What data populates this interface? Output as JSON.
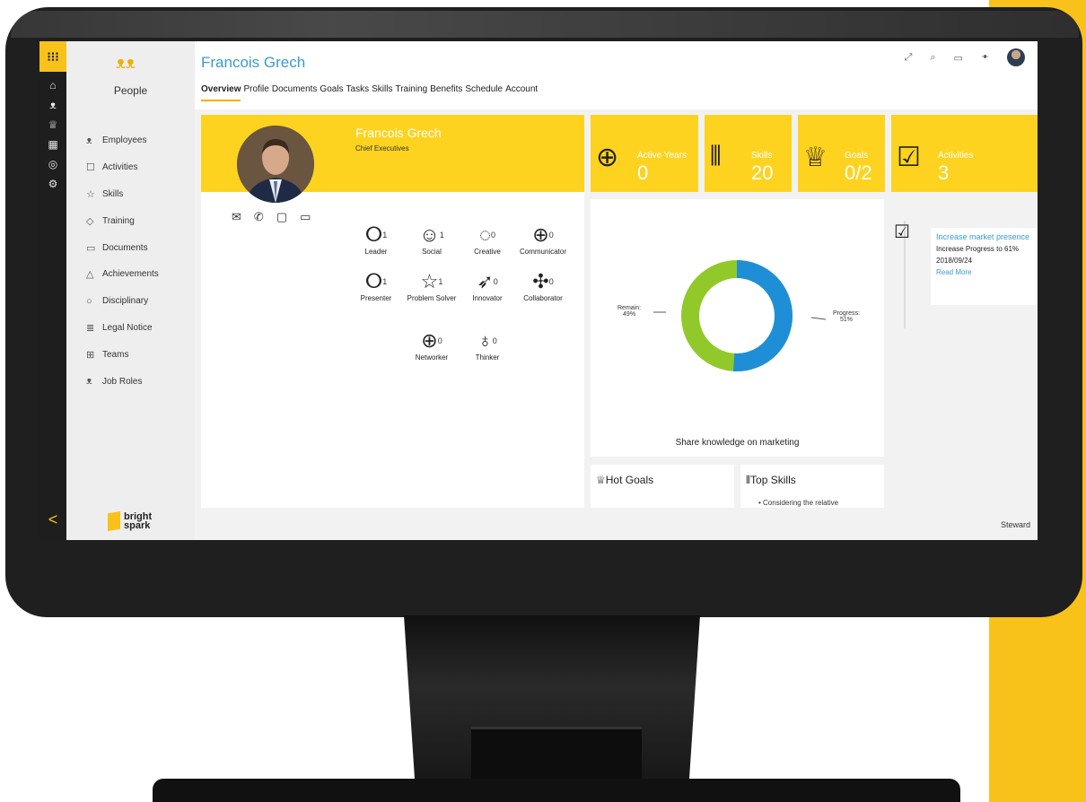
{
  "rail": {
    "icons": [
      "apps-waffle-icon",
      "home-icon",
      "people-icon",
      "trophy-icon",
      "calendar-icon",
      "target-icon",
      "settings-icon"
    ],
    "collapse_glyph": "<"
  },
  "sidebar": {
    "title": "People",
    "items": [
      {
        "label": "Employees",
        "icon": "people-icon"
      },
      {
        "label": "Activities",
        "icon": "clipboard-icon"
      },
      {
        "label": "Skills",
        "icon": "star-icon"
      },
      {
        "label": "Training",
        "icon": "graduation-icon"
      },
      {
        "label": "Documents",
        "icon": "document-icon"
      },
      {
        "label": "Achievements",
        "icon": "achievement-icon"
      },
      {
        "label": "Disciplinary",
        "icon": "disciplinary-icon"
      },
      {
        "label": "Legal Notice",
        "icon": "legal-icon"
      },
      {
        "label": "Teams",
        "icon": "teams-icon"
      },
      {
        "label": "Job Roles",
        "icon": "job-roles-icon"
      }
    ],
    "logo": {
      "line1": "bright",
      "line2": "spark"
    }
  },
  "header": {
    "title": "Francois Grech",
    "tabs": [
      "Overview",
      "Profile",
      "Documents",
      "Goals",
      "Tasks",
      "Skills",
      "Training",
      "Benefits",
      "Schedule",
      "Account"
    ],
    "active_tab": "Overview",
    "icons": [
      "expand-icon",
      "search-icon",
      "chat-icon",
      "org-chart-icon",
      "user-avatar"
    ]
  },
  "profile": {
    "name": "Francois Grech",
    "role": "Chief Executives",
    "contact_icons": [
      "mail-icon",
      "phone-icon",
      "message-icon",
      "video-icon"
    ],
    "traits": [
      {
        "label": "Leader",
        "count": "1",
        "icon": "leader-icon"
      },
      {
        "label": "Social",
        "count": "1",
        "icon": "smile-icon"
      },
      {
        "label": "Creative",
        "count": "0",
        "icon": "palette-icon"
      },
      {
        "label": "Communicator",
        "count": "0",
        "icon": "globe-person-icon"
      },
      {
        "label": "Presenter",
        "count": "1",
        "icon": "presenter-icon"
      },
      {
        "label": "Problem Solver",
        "count": "1",
        "icon": "star-outline-icon"
      },
      {
        "label": "Innovator",
        "count": "0",
        "icon": "rocket-icon"
      },
      {
        "label": "Collaborator",
        "count": "0",
        "icon": "puzzle-icon"
      },
      {
        "label": "Networker",
        "count": "0",
        "icon": "globe-icon"
      },
      {
        "label": "Thinker",
        "count": "0",
        "icon": "lightbulb-icon"
      }
    ]
  },
  "stats": [
    {
      "label": "Active Years",
      "value": "0",
      "icon": "globe-add-icon"
    },
    {
      "label": "Skills",
      "value": "20",
      "icon": "tools-icon"
    },
    {
      "label": "Goals",
      "value": "0/2",
      "icon": "trophy-icon"
    },
    {
      "label": "Activities",
      "value": "3",
      "icon": "clipboard-check-icon"
    }
  ],
  "goal_chart": {
    "caption": "Share knowledge on marketing",
    "remain_label": "Remain:",
    "remain_value": "49%",
    "progress_label": "Progress:",
    "progress_value": "51%",
    "progress_fraction": 0.51,
    "colors": {
      "progress": "#1e8fd6",
      "remain": "#92c92a"
    }
  },
  "activity": {
    "title": "Increase market presence",
    "detail": "Increase Progress to 61%",
    "date": "2018/09/24",
    "link": "Read More"
  },
  "hot_goals": {
    "title": "Hot Goals"
  },
  "top_skills": {
    "title": "Top Skills",
    "snippet": "• Considering the relative"
  },
  "footer": {
    "user": "Steward"
  },
  "colors": {
    "accent": "#fdd320",
    "brand_blue": "#3a9bd0",
    "rail": "#1e1e1e"
  }
}
